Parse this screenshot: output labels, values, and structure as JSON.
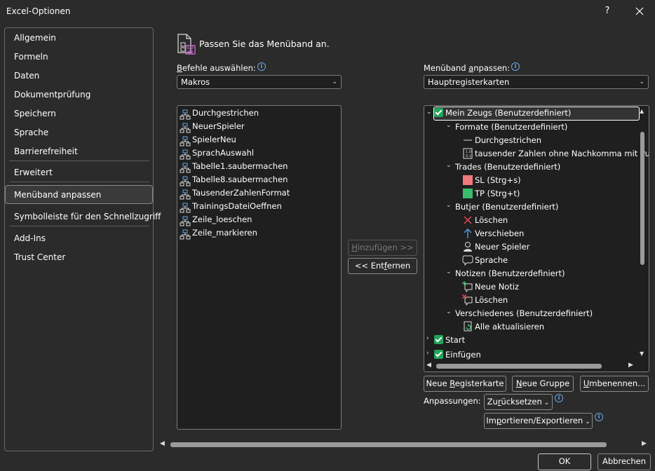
{
  "window": {
    "title": "Excel-Optionen",
    "help_label": "?",
    "close_icon": "close-icon"
  },
  "nav": {
    "items": [
      {
        "label": "Allgemein"
      },
      {
        "label": "Formeln"
      },
      {
        "label": "Daten"
      },
      {
        "label": "Dokumentprüfung"
      },
      {
        "label": "Speichern"
      },
      {
        "label": "Sprache"
      },
      {
        "label": "Barrierefreiheit"
      },
      {
        "label": "Erweitert"
      },
      {
        "label": "Menüband anpassen"
      },
      {
        "label": "Symbolleiste für den Schnellzugriff"
      },
      {
        "label": "Add-Ins"
      },
      {
        "label": "Trust Center"
      }
    ],
    "selected": "Menüband anpassen"
  },
  "header": {
    "title": "Passen Sie das Menüband an."
  },
  "commands": {
    "label": "Befehle auswählen:",
    "label_access_key": "B",
    "label_rest": "efehle auswählen:",
    "selected": "Makros",
    "items": [
      "Durchgestrichen",
      "NeuerSpieler",
      "SpielerNeu",
      "SprachAuswahl",
      "Tabelle1.saubermachen",
      "Tabelle8.saubermachen",
      "TausenderZahlenFormat",
      "TrainingsDateiOeffnen",
      "Zeile_loeschen",
      "Zeile_markieren"
    ]
  },
  "ribbon": {
    "label_pre": "Menüband ",
    "label_access_key": "a",
    "label_rest": "npassen:",
    "selected": "Hauptregisterkarten",
    "tree": {
      "tab": "Mein Zeugs (Benutzerdefiniert)",
      "groups": [
        {
          "name": "Formate (Benutzerdefiniert)",
          "items": [
            "Durchgestrichen",
            "tausender Zahlen ohne Nachkomma mit Pu"
          ]
        },
        {
          "name": "Trades (Benutzerdefiniert)",
          "items": [
            "SL (Strg+s)",
            "TP (Strg+t)"
          ]
        },
        {
          "name": "Butjer (Benutzerdefiniert)",
          "items": [
            "Löschen",
            "Verschieben",
            "Neuer Spieler",
            "Sprache"
          ]
        },
        {
          "name": "Notizen (Benutzerdefiniert)",
          "items": [
            "Neue Notiz",
            "Löschen"
          ]
        },
        {
          "name": "Verschiedenes (Benutzerdefiniert)",
          "items": [
            "Alle aktualisieren"
          ]
        }
      ],
      "other_tabs": [
        "Start",
        "Einfügen"
      ]
    }
  },
  "buttons": {
    "add": {
      "pre": "",
      "key": "H",
      "rest": "inzufügen >>"
    },
    "remove": {
      "pre": "<< Ent",
      "key": "f",
      "rest": "ernen"
    },
    "new_tab": {
      "pre": "Neue ",
      "key": "R",
      "rest": "egisterkarte"
    },
    "new_group": {
      "pre": "",
      "key": "N",
      "rest": "eue Gruppe"
    },
    "rename": {
      "pre": "",
      "key": "U",
      "rest": "mbenennen..."
    },
    "reset": {
      "pre": "Zu",
      "key": "r",
      "rest": "ücksetzen"
    },
    "import_export": {
      "pre": "Im",
      "key": "p",
      "rest": "ortieren/Exportieren"
    },
    "ok": "OK",
    "cancel": "Abbrechen"
  },
  "customizations": {
    "label": "Anpassungen:"
  },
  "colors": {
    "background": "#2b2b2b",
    "listbox": "#1f1f1f",
    "check": "#22a55a",
    "sl_swatch": "#f0787e",
    "tp_swatch": "#3cba6e",
    "info": "#6aa6e8"
  }
}
